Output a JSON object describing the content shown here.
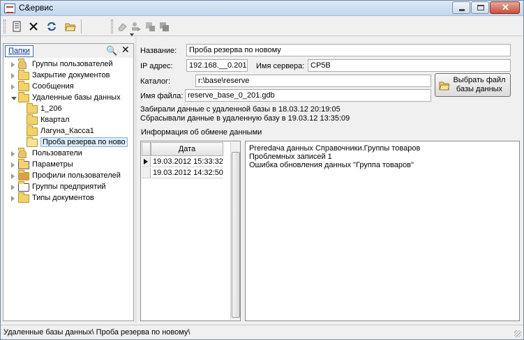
{
  "window": {
    "title": "С&ервис"
  },
  "toolbar": {
    "buttons": [
      {
        "name": "document-icon"
      },
      {
        "name": "delete-icon"
      },
      {
        "name": "refresh-icon"
      },
      {
        "name": "open-folder-icon"
      },
      {
        "name": "eraser-icon",
        "disabled": true
      },
      {
        "name": "copy-user-icon",
        "disabled": true
      },
      {
        "name": "delete-record-icon",
        "disabled": true
      },
      {
        "name": "duplicate-icon",
        "disabled": true
      }
    ]
  },
  "sidebar": {
    "tab_label": "Папки",
    "items": [
      {
        "label": "Группы пользователей",
        "icon": "users-icon",
        "expander": "closed"
      },
      {
        "label": "Закрытие документов",
        "icon": "folder-icon",
        "expander": "closed"
      },
      {
        "label": "Сообщения",
        "icon": "folder-icon",
        "expander": "closed"
      },
      {
        "label": "Удаленные базы данных",
        "icon": "folder-icon",
        "expander": "open"
      },
      {
        "label": "1_206",
        "icon": "folder-icon",
        "expander": "none"
      },
      {
        "label": "Квартал",
        "icon": "folder-icon",
        "expander": "none"
      },
      {
        "label": "Лагуна_Касса1",
        "icon": "folder-icon",
        "expander": "none"
      },
      {
        "label": "Проба резерва по ново",
        "icon": "open-folder-icon",
        "expander": "none",
        "selected": true
      },
      {
        "label": "Пользователи",
        "icon": "user-icon",
        "expander": "closed"
      },
      {
        "label": "Параметры",
        "icon": "settings-icon",
        "expander": "closed"
      },
      {
        "label": "Профили пользователей",
        "icon": "profiles-icon",
        "expander": "closed"
      },
      {
        "label": "Группы предприятий",
        "icon": "document-icon",
        "expander": "closed"
      },
      {
        "label": "Типы документов",
        "icon": "folder-icon",
        "expander": "closed"
      }
    ]
  },
  "form": {
    "name_label": "Название:",
    "name_value": "Проба резерва по новому",
    "ip_label": "IP адрес:",
    "ip_value": "192.168.__0.201",
    "server_label": "Имя сервера:",
    "server_value": "CP5B",
    "catalog_label": "Каталог:",
    "catalog_value": "r:\\base\\reserve",
    "file_label": "Имя файла:",
    "file_value": "reserve_base_0_201.gdb",
    "browse_button": "Выбрать файл базы данных"
  },
  "info": {
    "line1": "Забирали данные с удаленной базы в 18.03.12 20:19:05",
    "line2": "Сбрасывали данные в удаленную базу в 19.03.12 13:35:09",
    "exchange_title": "Информация об обмене данными"
  },
  "exchange_grid": {
    "column": "Дата",
    "rows": [
      "19.03.2012 15:33:32",
      "19.03.2012 14:32:50"
    ]
  },
  "detail": {
    "lines": [
      "Рreredача данных Справочники.Группы товаров",
      "Проблемных записей 1",
      "Ошибка обновления данных \"Группа товаров\""
    ]
  },
  "status": {
    "path": "Удаленные базы данных\\ Проба резерва по новому\\"
  }
}
